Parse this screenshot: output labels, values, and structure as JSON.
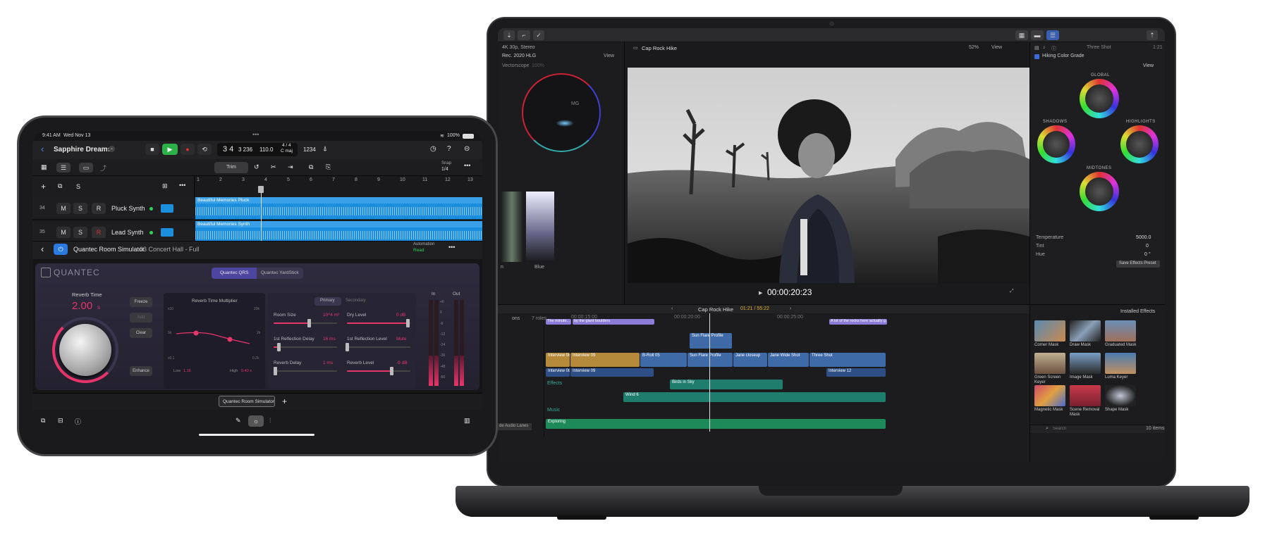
{
  "macbook": {
    "fcp": {
      "format": "4K 30p, Stereo",
      "color_space": "Rec. 2020 HLG",
      "scopes_view": "View",
      "scope_name": "Vectorscope",
      "scope_mode": "100%",
      "scope_label_mg": "MG",
      "wave_label": "Blue",
      "wave_label2": "n",
      "viewer_title": "Cap Rock Hike",
      "zoom": "52%",
      "viewer_view": "View",
      "timecode": "00:00:20:23",
      "inspector_title": "Three Shot",
      "inspector_time": "1:21",
      "grade_name": "Hiking Color Grade",
      "inspector_view": "View",
      "wheels": {
        "global": "GLOBAL",
        "shadows": "SHADOWS",
        "highlights": "HIGHLIGHTS",
        "midtones": "MIDTONES"
      },
      "params": [
        {
          "name": "Temperature",
          "value": "5000.0"
        },
        {
          "name": "Tint",
          "value": "0"
        },
        {
          "name": "Hue",
          "value": "0 °"
        }
      ],
      "save_effects": "Save Effects Preset",
      "timeline": {
        "project": "Cap Rock Hike",
        "duration": "01:21 / 55:22",
        "ruler": [
          "00:00:15:00",
          "00:00:20:00",
          "00:00:25:00"
        ],
        "index_header": "ons",
        "index_count": "7 roles",
        "audio_lanes_btn": "de Audio Lanes",
        "captions": [
          "The minute...",
          "by the giant boulders",
          "A lot of the rocks here actually g..."
        ],
        "connected": [
          "Sun Flare Profile"
        ],
        "primary": [
          "Interview 08",
          "Interview 09",
          "B-Roll 05",
          "Sun Flare Profile",
          "Jane closeup",
          "Jane Wide Shot",
          "Three Shot"
        ],
        "interview_audio": [
          "Interview 08",
          "Interview 09",
          "Interview 12"
        ],
        "effects_lane": "Effects",
        "effects_clips": [
          "Birds in Sky",
          "Wind 6"
        ],
        "music_lane": "Music",
        "music_clip": "Exploring"
      },
      "browser": {
        "title": "Installed Effects",
        "effects": [
          {
            "name": "Corner Mask"
          },
          {
            "name": "Draw Mask"
          },
          {
            "name": "Graduated Mask"
          },
          {
            "name": "Green Screen Keyer"
          },
          {
            "name": "Image Mask"
          },
          {
            "name": "Luma Keyer"
          },
          {
            "name": "Magnetic Mask"
          },
          {
            "name": "Scene Removal Mask"
          },
          {
            "name": "Shape Mask"
          }
        ],
        "search_placeholder": "Search",
        "count": "10 items"
      }
    }
  },
  "ipad": {
    "status": {
      "time": "9:41 AM",
      "date": "Wed Nov 13",
      "battery": "100%"
    },
    "project": "Sapphire Dreams",
    "lcd": {
      "position": "3 4",
      "beat": "3 236",
      "tempo": "110.0",
      "signature": "4 / 4",
      "key": "C maj",
      "count_in": "1234"
    },
    "trim_label": "Trim",
    "snap": {
      "label": "Snap",
      "value": "1/4"
    },
    "ruler": [
      "1",
      "2",
      "3",
      "4",
      "5",
      "6",
      "7",
      "8",
      "9",
      "10",
      "11",
      "12",
      "13"
    ],
    "tracks": [
      {
        "number": "34",
        "name": "Pluck Synth",
        "region": "Beautiful Memories Pluck"
      },
      {
        "number": "35",
        "name": "Lead Synth",
        "region": "Beautiful Memories Synth"
      }
    ],
    "track_buttons": {
      "mute": "M",
      "solo": "S",
      "record": "R"
    },
    "track_header_s": "S",
    "plugin": {
      "name": "Quantec Room Simulator",
      "preset": "03 Concert Hall - Full",
      "automation": "Automation",
      "automation_mode": "Read",
      "brand": "QUANTEC",
      "tabs": [
        "Quantec QRS",
        "Quantec YardStick"
      ],
      "reverb_time_label": "Reverb Time",
      "reverb_time_value": "2.00",
      "reverb_time_unit": "s",
      "side_buttons": [
        "Freeze",
        "Add",
        "Clear",
        "Enhance"
      ],
      "multiplier_title": "Reverb Time Multiplier",
      "multiplier_axes": [
        "x10",
        "20k",
        "5k",
        "2k",
        "x0.1",
        "0.2k"
      ],
      "multiplier_low": "Low",
      "multiplier_low_val": "1.16",
      "multiplier_high": "High",
      "multiplier_high_val": "0.40 x",
      "mode_tabs": [
        "Primary",
        "Secondary"
      ],
      "params": [
        {
          "name": "Room Size",
          "value": "10^4 m³",
          "level": 0.55
        },
        {
          "name": "Dry Level",
          "value": "0 dB",
          "level": 0.95
        },
        {
          "name": "1st Reflection Delay",
          "value": "16 ms",
          "level": 0.08
        },
        {
          "name": "1st Reflection Level",
          "value": "Mute",
          "level": 0.0
        },
        {
          "name": "Reverb Delay",
          "value": "1 ms",
          "level": 0.02
        },
        {
          "name": "Reverb Level",
          "value": "-9 dB",
          "level": 0.7
        }
      ],
      "meter_in": "In",
      "meter_out": "Out",
      "meter_scale": [
        "+6",
        "0",
        "-6",
        "-12",
        "-24",
        "-36",
        "-48",
        "-60"
      ],
      "meter_in_level": 0.35,
      "meter_out_level": 0.35,
      "slot_label": "Quantec Room Simulator"
    }
  }
}
